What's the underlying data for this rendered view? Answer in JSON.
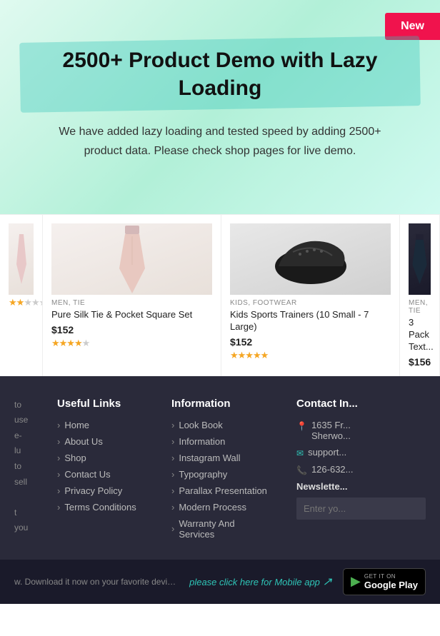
{
  "hero": {
    "badge": "New",
    "title": "2500+ Product Demo with Lazy Loading",
    "subtitle": "We have added lazy loading and tested speed by adding 2500+ product data. Please check shop pages for live demo."
  },
  "products": [
    {
      "meta": "MEN, TIE",
      "name": "Pure Silk Tie & Pocket Square Set",
      "price": "$152",
      "stars": 3.5,
      "type": "tie"
    },
    {
      "meta": "KIDS, FOOTWEAR",
      "name": "Kids Sports Trainers (10 Small - 7 Large)",
      "price": "$152",
      "stars": 5,
      "type": "shoe"
    },
    {
      "meta": "MEN, TIE",
      "name": "3 Pack Text...",
      "price": "$156",
      "stars": 0,
      "type": "tie-dark"
    }
  ],
  "footer": {
    "useful_links": {
      "title": "Useful Links",
      "items": [
        "Home",
        "About Us",
        "Shop",
        "Contact Us",
        "Privacy Policy",
        "Terms Conditions"
      ]
    },
    "information": {
      "title": "Information",
      "items": [
        "Look Book",
        "Information",
        "Instagram Wall",
        "Typography",
        "Parallax Presentation",
        "Modern Process",
        "Warranty And Services"
      ]
    },
    "contact": {
      "title": "Contact In...",
      "address": "1635 Fr... Sherwo...",
      "email": "support...",
      "phone": "126-632..."
    },
    "newsletter": {
      "title": "Newslette...",
      "placeholder": "Enter yo..."
    }
  },
  "bottom_bar": {
    "left_text": "w. Download it now on your favorite device and indulge in",
    "mobile_cta": "please click here for Mobile app",
    "google_play": {
      "get_it": "GET IT ON",
      "store": "Google Play"
    }
  }
}
